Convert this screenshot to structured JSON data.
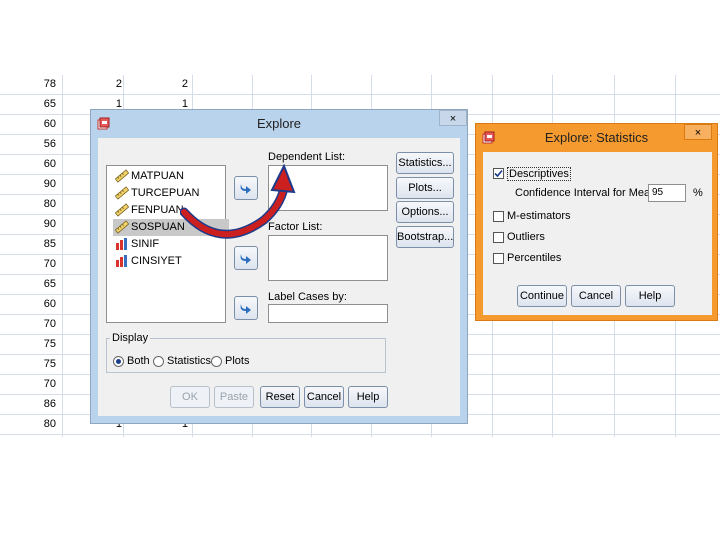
{
  "spreadsheet": {
    "rows": [
      [
        "78",
        "2",
        "2"
      ],
      [
        "65",
        "1",
        "1"
      ],
      [
        "60",
        "",
        ""
      ],
      [
        "56",
        "",
        ""
      ],
      [
        "60",
        "",
        ""
      ],
      [
        "90",
        "",
        ""
      ],
      [
        "80",
        "",
        ""
      ],
      [
        "90",
        "",
        ""
      ],
      [
        "85",
        "",
        ""
      ],
      [
        "70",
        "",
        ""
      ],
      [
        "65",
        "",
        ""
      ],
      [
        "60",
        "",
        ""
      ],
      [
        "70",
        "",
        ""
      ],
      [
        "75",
        "",
        ""
      ],
      [
        "75",
        "",
        ""
      ],
      [
        "70",
        "",
        ""
      ],
      [
        "86",
        "",
        ""
      ],
      [
        "80",
        "1",
        "1"
      ]
    ]
  },
  "explore": {
    "title": "Explore",
    "close": "×",
    "variables": [
      {
        "name": "MATPUAN",
        "type": "scale"
      },
      {
        "name": "TURCEPUAN",
        "type": "scale"
      },
      {
        "name": "FENPUAN",
        "type": "scale"
      },
      {
        "name": "SOSPUAN",
        "type": "scale",
        "selected": true
      },
      {
        "name": "SINIF",
        "type": "nominal"
      },
      {
        "name": "CINSIYET",
        "type": "nominal"
      }
    ],
    "dependent_label": "Dependent List:",
    "factor_label": "Factor List:",
    "label_cases_label": "Label Cases by:",
    "side_buttons": [
      "Statistics...",
      "Plots...",
      "Options...",
      "Bootstrap..."
    ],
    "display": {
      "legend": "Display",
      "options": [
        "Both",
        "Statistics",
        "Plots"
      ],
      "selected": "Both"
    },
    "bottom_buttons": [
      "OK",
      "Paste",
      "Reset",
      "Cancel",
      "Help"
    ]
  },
  "stats": {
    "title": "Explore: Statistics",
    "close": "×",
    "descriptives_label": "Descriptives",
    "ci_label": "Confidence Interval for Mean:",
    "ci_value": "95",
    "ci_unit": "%",
    "m_estimators_label": "M-estimators",
    "outliers_label": "Outliers",
    "percentiles_label": "Percentiles",
    "buttons": [
      "Continue",
      "Cancel",
      "Help"
    ]
  },
  "colors": {
    "stats_border": "#f59a2e",
    "explore_border": "#b9d3ec",
    "annotation_arrow": "#cc1f1f"
  }
}
